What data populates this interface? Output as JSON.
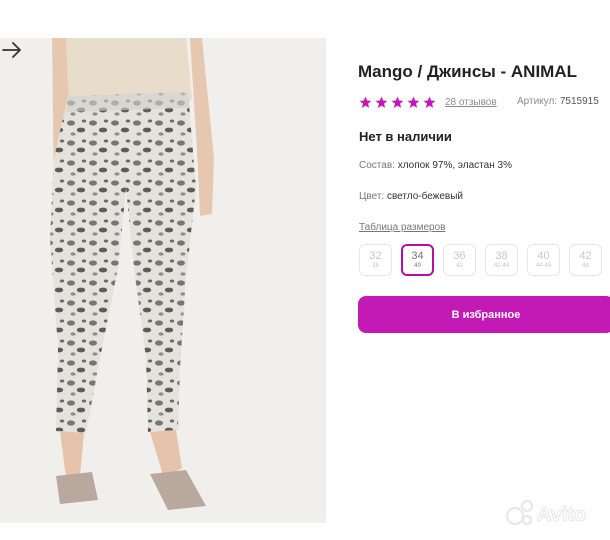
{
  "product": {
    "title": "Mango / Джинсы - ANIMAL",
    "rating_stars": 5,
    "reviews": "28 отзывов",
    "article_label": "Артикул:",
    "article_value": "7515915",
    "stock_status": "Нет в наличии",
    "composition_label": "Состав:",
    "composition_value": "хлопок 97%, эластан 3%",
    "color_label": "Цвет:",
    "color_value": "светло-бежевый",
    "size_table_label": "Таблица размеров",
    "sizes": [
      {
        "size": "32",
        "ru": "38",
        "selected": false
      },
      {
        "size": "34",
        "ru": "40",
        "selected": true
      },
      {
        "size": "36",
        "ru": "42",
        "selected": false
      },
      {
        "size": "38",
        "ru": "42-44",
        "selected": false
      },
      {
        "size": "40",
        "ru": "44-46",
        "selected": false
      },
      {
        "size": "42",
        "ru": "48",
        "selected": false
      }
    ],
    "favorite_button": "В избранное"
  },
  "icons": {
    "star": "star-icon",
    "next": "arrow-right-icon",
    "watermark": "avito-logo"
  },
  "colors": {
    "accent": "#c41ab5",
    "star": "#c41ab5",
    "selected_size_border": "#b40ea6"
  },
  "watermark": "Avito"
}
